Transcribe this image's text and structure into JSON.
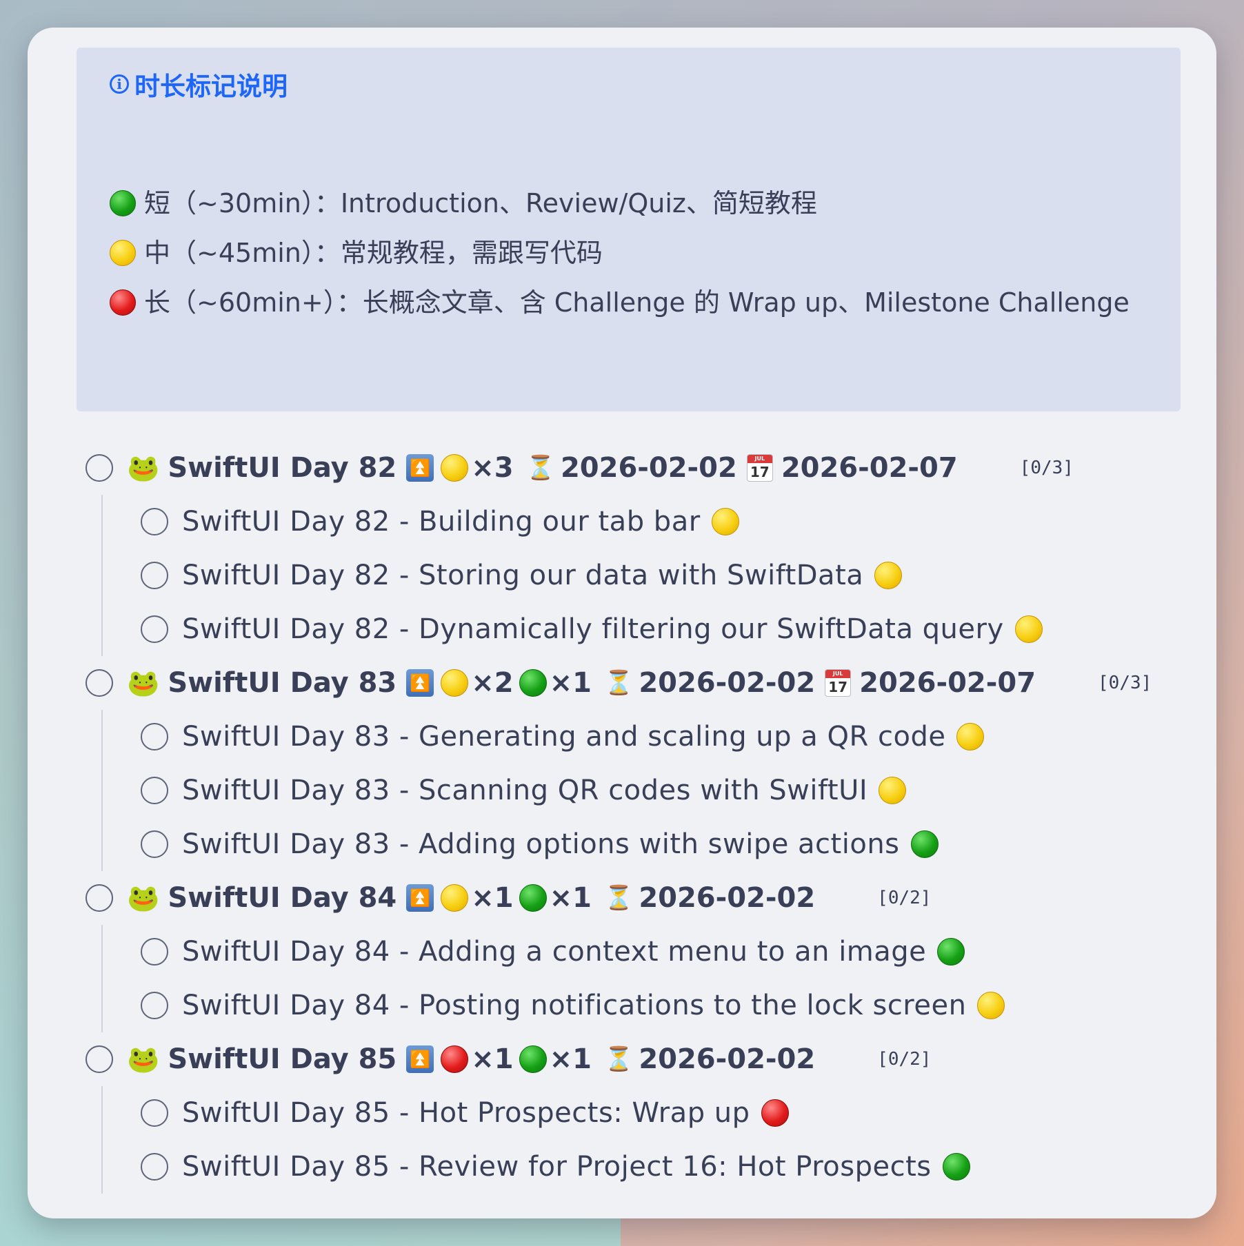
{
  "callout": {
    "title": "时长标记说明",
    "legend": [
      {
        "dot": "green",
        "text": "短（~30min）：Introduction、Review/Quiz、简短教程"
      },
      {
        "dot": "yellow",
        "text": "中（~45min）：常规教程，需跟写代码"
      },
      {
        "dot": "red",
        "text": "长（~60min+）：长概念文章、含 Challenge 的 Wrap up、Milestone Challenge"
      }
    ]
  },
  "colors": {
    "accent": "#1e66f5",
    "green": "#16a016",
    "yellow": "#f7cf12",
    "red": "#e31c1c"
  },
  "icons": {
    "parent": "frog-icon",
    "priority": "double-up-arrow-icon",
    "duration": "hourglass-icon",
    "scheduled": "calendar-icon"
  },
  "groups": [
    {
      "title": "SwiftUI Day 82",
      "mult1": "×3",
      "mult2": "",
      "start": "2026-02-02",
      "cal_day": "17",
      "cal_month": "JUL",
      "due": "2026-02-07",
      "count": "[0/3]",
      "tasks": [
        {
          "text": "SwiftUI Day 82 - Building our tab bar",
          "dot": "yellow"
        },
        {
          "text": "SwiftUI Day 82 - Storing our data with SwiftData",
          "dot": "yellow"
        },
        {
          "text": "SwiftUI Day 82 - Dynamically filtering our SwiftData query",
          "dot": "yellow"
        }
      ]
    },
    {
      "title": "SwiftUI Day 83",
      "mult1": "×2",
      "mult2": "×1",
      "start": "2026-02-02",
      "cal_day": "17",
      "cal_month": "JUL",
      "due": "2026-02-07",
      "count": "[0/3]",
      "tasks": [
        {
          "text": "SwiftUI Day 83 - Generating and scaling up a QR code",
          "dot": "yellow"
        },
        {
          "text": "SwiftUI Day 83 - Scanning QR codes with SwiftUI",
          "dot": "yellow"
        },
        {
          "text": "SwiftUI Day 83 - Adding options with swipe actions",
          "dot": "green"
        }
      ]
    },
    {
      "title": "SwiftUI Day 84",
      "mult1": "×1",
      "mult2": "×1",
      "start": "2026-02-02",
      "count": "[0/2]",
      "tasks": [
        {
          "text": "SwiftUI Day 84 - Adding a context menu to an image",
          "dot": "green"
        },
        {
          "text": "SwiftUI Day 84 - Posting notifications to the lock screen",
          "dot": "yellow"
        }
      ]
    },
    {
      "title": "SwiftUI Day 85",
      "mult1": "×1",
      "mult2": "×1",
      "start": "2026-02-02",
      "count": "[0/2]",
      "tasks": [
        {
          "text": "SwiftUI Day 85 - Hot Prospects: Wrap up",
          "dot": "red"
        },
        {
          "text": "SwiftUI Day 85 - Review for Project 16: Hot Prospects",
          "dot": "green"
        }
      ]
    }
  ]
}
